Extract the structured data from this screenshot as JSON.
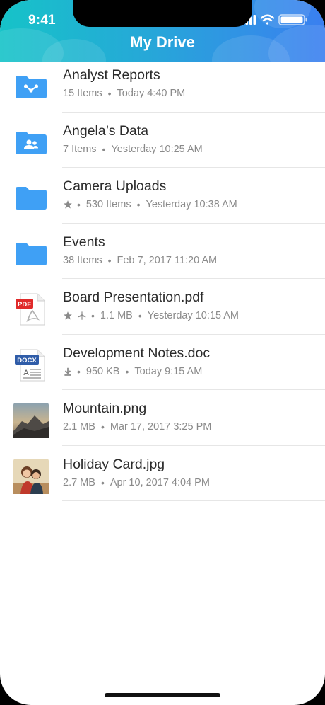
{
  "status_bar": {
    "time": "9:41"
  },
  "header": {
    "title": "My Drive"
  },
  "files": [
    {
      "name": "Analyst Reports",
      "icon": "shared-folder-icon",
      "meta": [
        "15 Items",
        "Today 4:40 PM"
      ],
      "flags": []
    },
    {
      "name": "Angela’s Data",
      "icon": "people-folder-icon",
      "meta": [
        "7 Items",
        "Yesterday 10:25 AM"
      ],
      "flags": []
    },
    {
      "name": "Camera Uploads",
      "icon": "folder-icon",
      "meta": [
        "530 Items",
        "Yesterday 10:38 AM"
      ],
      "flags": [
        "star"
      ]
    },
    {
      "name": "Events",
      "icon": "folder-icon",
      "meta": [
        "38 Items",
        "Feb 7, 2017 11:20 AM"
      ],
      "flags": []
    },
    {
      "name": "Board Presentation.pdf",
      "icon": "pdf-file-icon",
      "badge": "PDF",
      "meta": [
        "1.1 MB",
        "Yesterday 10:15 AM"
      ],
      "flags": [
        "star",
        "offline"
      ]
    },
    {
      "name": "Development Notes.doc",
      "icon": "docx-file-icon",
      "badge": "DOCX",
      "meta": [
        "950 KB",
        "Today 9:15 AM"
      ],
      "flags": [
        "download"
      ]
    },
    {
      "name": "Mountain.png",
      "icon": "mountain-thumbnail",
      "meta": [
        "2.1 MB",
        "Mar 17, 2017 3:25 PM"
      ],
      "flags": []
    },
    {
      "name": "Holiday Card.jpg",
      "icon": "photo-thumbnail",
      "meta": [
        "2.7 MB",
        "Apr 10, 2017 4:04 PM"
      ],
      "flags": []
    }
  ],
  "colors": {
    "header_start": "#16c3c8",
    "header_end": "#3a7ff0",
    "folder": "#3fa0f5",
    "pdf_red": "#e02a2a",
    "docx_blue": "#2f5ca8"
  }
}
